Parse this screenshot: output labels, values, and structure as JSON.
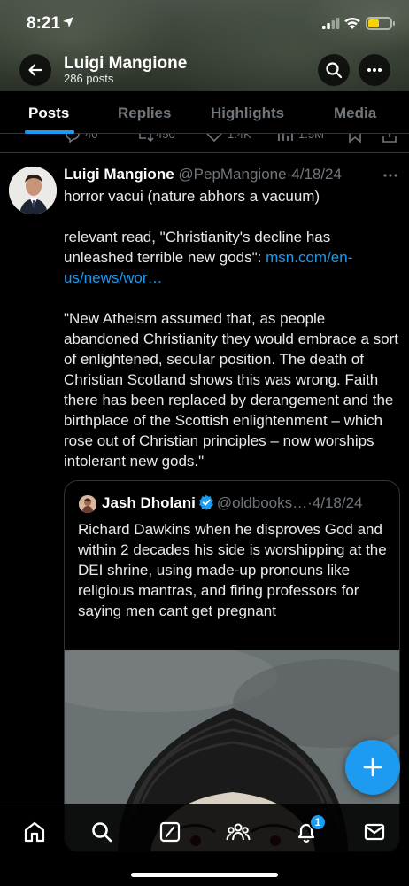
{
  "status_bar": {
    "time": "8:21"
  },
  "header": {
    "profile_name": "Luigi Mangione",
    "post_count": "286 posts"
  },
  "tabs": [
    {
      "label": "Posts",
      "active": true
    },
    {
      "label": "Replies",
      "active": false
    },
    {
      "label": "Highlights",
      "active": false
    },
    {
      "label": "Media",
      "active": false
    }
  ],
  "prev_tweet_actions": {
    "replies": "40",
    "reposts": "450",
    "likes": "1.4K",
    "views": "1.5M"
  },
  "tweet": {
    "name": "Luigi Mangione",
    "handle": "@PepMangione",
    "separator": "·",
    "date": "4/18/24",
    "line1": "horror vacui (nature abhors a vacuum)",
    "line2_prefix": "relevant read, \"Christianity's decline has unleashed terrible new gods\": ",
    "line2_link": "msn.com/en-us/news/wor…",
    "line3": "\"New Atheism assumed that, as people abandoned Christianity they would embrace a sort of enlightened, secular position. The death of Christian Scotland shows this was wrong. Faith there has been replaced by derangement and the birthplace of the Scottish enlightenment – which rose out of Christian principles – now worships intolerant new gods.\""
  },
  "quote": {
    "name": "Jash Dholani",
    "handle": "@oldbooks…",
    "separator": "·",
    "date": "4/18/24",
    "text": "Richard Dawkins when he disproves God and within 2 decades his side is worshipping at the DEI shrine, using made-up pronouns like religious mantras, and firing professors for saying men cant get pregnant"
  },
  "bottom_nav": {
    "items": [
      "home-icon",
      "search-icon",
      "grok-icon",
      "communities-icon",
      "notifications-icon",
      "messages-icon"
    ],
    "notification_count": "1"
  },
  "colors": {
    "accent": "#1d9bf0",
    "background": "#000000",
    "secondary_text": "#71767b"
  }
}
